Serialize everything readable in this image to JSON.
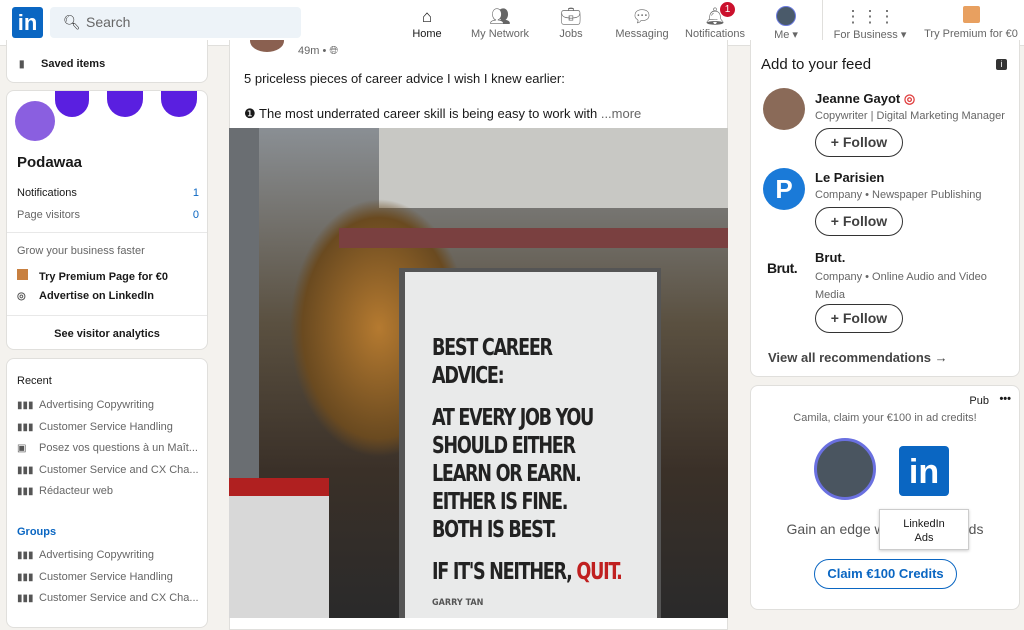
{
  "header": {
    "search_placeholder": "Search",
    "nav": [
      {
        "label": "Home",
        "icon": "home-icon"
      },
      {
        "label": "My Network",
        "icon": "network-icon"
      },
      {
        "label": "Jobs",
        "icon": "briefcase-icon"
      },
      {
        "label": "Messaging",
        "icon": "chat-icon"
      },
      {
        "label": "Notifications",
        "icon": "bell-icon",
        "badge": "1"
      },
      {
        "label": "Me",
        "icon": "avatar"
      },
      {
        "label": "For Business",
        "icon": "grid-icon"
      },
      {
        "label": "Try Premium for €0",
        "icon": "premium-icon"
      }
    ]
  },
  "left": {
    "saved": "Saved items",
    "page_name": "Podawaa",
    "notifications_label": "Notifications",
    "notifications_count": "1",
    "visitors_label": "Page visitors",
    "visitors_count": "0",
    "grow": "Grow your business faster",
    "premium": "Try Premium Page for €0",
    "advertise": "Advertise on LinkedIn",
    "analytics": "See visitor analytics",
    "recent_title": "Recent",
    "recent": [
      "Advertising Copywriting",
      "Customer Service Handling",
      "Posez vos questions à un Maît...",
      "Customer Service and CX Cha...",
      "Rédacteur web"
    ],
    "groups_title": "Groups",
    "groups": [
      "Advertising Copywriting",
      "Customer Service Handling",
      "Customer Service and CX Cha..."
    ]
  },
  "post": {
    "time": "49m •",
    "text": "5 priceless pieces of career advice I wish I knew earlier:",
    "point": "The most underrated career skill is being easy to work with",
    "more": "...more",
    "poster": [
      "BEST CAREER ADVICE:",
      "",
      "AT EVERY JOB YOU",
      "SHOULD EITHER",
      "LEARN OR EARN.",
      "EITHER IS FINE.",
      "BOTH IS BEST.",
      "",
      "IF IT'S NEITHER, "
    ],
    "poster_quit": "QUIT.",
    "poster_author": "GARRY TAN"
  },
  "feed": {
    "title": "Add to your feed",
    "items": [
      {
        "name": "Jeanne Gayot",
        "sub": "Copywriter | Digital Marketing Manager"
      },
      {
        "name": "Le Parisien",
        "sub": "Company • Newspaper Publishing"
      },
      {
        "name": "Brut.",
        "sub": "Company • Online Audio and Video Media"
      }
    ],
    "follow": "+ Follow",
    "view_all": "View all recommendations →"
  },
  "ad": {
    "label": "Pub",
    "more": "•••",
    "headline": "Camila, claim your €100 in ad credits!",
    "body": "Gain an edge with LinkedIn Ads",
    "tooltip": "LinkedIn Ads",
    "cta": "Claim €100 Credits"
  }
}
